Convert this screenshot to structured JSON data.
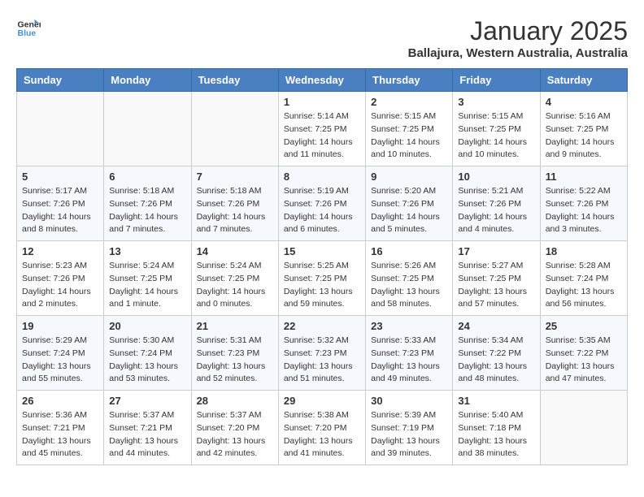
{
  "logo": {
    "line1": "General",
    "line2": "Blue"
  },
  "title": "January 2025",
  "subtitle": "Ballajura, Western Australia, Australia",
  "weekdays": [
    "Sunday",
    "Monday",
    "Tuesday",
    "Wednesday",
    "Thursday",
    "Friday",
    "Saturday"
  ],
  "weeks": [
    [
      {
        "day": "",
        "info": ""
      },
      {
        "day": "",
        "info": ""
      },
      {
        "day": "",
        "info": ""
      },
      {
        "day": "1",
        "info": "Sunrise: 5:14 AM\nSunset: 7:25 PM\nDaylight: 14 hours\nand 11 minutes."
      },
      {
        "day": "2",
        "info": "Sunrise: 5:15 AM\nSunset: 7:25 PM\nDaylight: 14 hours\nand 10 minutes."
      },
      {
        "day": "3",
        "info": "Sunrise: 5:15 AM\nSunset: 7:25 PM\nDaylight: 14 hours\nand 10 minutes."
      },
      {
        "day": "4",
        "info": "Sunrise: 5:16 AM\nSunset: 7:25 PM\nDaylight: 14 hours\nand 9 minutes."
      }
    ],
    [
      {
        "day": "5",
        "info": "Sunrise: 5:17 AM\nSunset: 7:26 PM\nDaylight: 14 hours\nand 8 minutes."
      },
      {
        "day": "6",
        "info": "Sunrise: 5:18 AM\nSunset: 7:26 PM\nDaylight: 14 hours\nand 7 minutes."
      },
      {
        "day": "7",
        "info": "Sunrise: 5:18 AM\nSunset: 7:26 PM\nDaylight: 14 hours\nand 7 minutes."
      },
      {
        "day": "8",
        "info": "Sunrise: 5:19 AM\nSunset: 7:26 PM\nDaylight: 14 hours\nand 6 minutes."
      },
      {
        "day": "9",
        "info": "Sunrise: 5:20 AM\nSunset: 7:26 PM\nDaylight: 14 hours\nand 5 minutes."
      },
      {
        "day": "10",
        "info": "Sunrise: 5:21 AM\nSunset: 7:26 PM\nDaylight: 14 hours\nand 4 minutes."
      },
      {
        "day": "11",
        "info": "Sunrise: 5:22 AM\nSunset: 7:26 PM\nDaylight: 14 hours\nand 3 minutes."
      }
    ],
    [
      {
        "day": "12",
        "info": "Sunrise: 5:23 AM\nSunset: 7:26 PM\nDaylight: 14 hours\nand 2 minutes."
      },
      {
        "day": "13",
        "info": "Sunrise: 5:24 AM\nSunset: 7:25 PM\nDaylight: 14 hours\nand 1 minute."
      },
      {
        "day": "14",
        "info": "Sunrise: 5:24 AM\nSunset: 7:25 PM\nDaylight: 14 hours\nand 0 minutes."
      },
      {
        "day": "15",
        "info": "Sunrise: 5:25 AM\nSunset: 7:25 PM\nDaylight: 13 hours\nand 59 minutes."
      },
      {
        "day": "16",
        "info": "Sunrise: 5:26 AM\nSunset: 7:25 PM\nDaylight: 13 hours\nand 58 minutes."
      },
      {
        "day": "17",
        "info": "Sunrise: 5:27 AM\nSunset: 7:25 PM\nDaylight: 13 hours\nand 57 minutes."
      },
      {
        "day": "18",
        "info": "Sunrise: 5:28 AM\nSunset: 7:24 PM\nDaylight: 13 hours\nand 56 minutes."
      }
    ],
    [
      {
        "day": "19",
        "info": "Sunrise: 5:29 AM\nSunset: 7:24 PM\nDaylight: 13 hours\nand 55 minutes."
      },
      {
        "day": "20",
        "info": "Sunrise: 5:30 AM\nSunset: 7:24 PM\nDaylight: 13 hours\nand 53 minutes."
      },
      {
        "day": "21",
        "info": "Sunrise: 5:31 AM\nSunset: 7:23 PM\nDaylight: 13 hours\nand 52 minutes."
      },
      {
        "day": "22",
        "info": "Sunrise: 5:32 AM\nSunset: 7:23 PM\nDaylight: 13 hours\nand 51 minutes."
      },
      {
        "day": "23",
        "info": "Sunrise: 5:33 AM\nSunset: 7:23 PM\nDaylight: 13 hours\nand 49 minutes."
      },
      {
        "day": "24",
        "info": "Sunrise: 5:34 AM\nSunset: 7:22 PM\nDaylight: 13 hours\nand 48 minutes."
      },
      {
        "day": "25",
        "info": "Sunrise: 5:35 AM\nSunset: 7:22 PM\nDaylight: 13 hours\nand 47 minutes."
      }
    ],
    [
      {
        "day": "26",
        "info": "Sunrise: 5:36 AM\nSunset: 7:21 PM\nDaylight: 13 hours\nand 45 minutes."
      },
      {
        "day": "27",
        "info": "Sunrise: 5:37 AM\nSunset: 7:21 PM\nDaylight: 13 hours\nand 44 minutes."
      },
      {
        "day": "28",
        "info": "Sunrise: 5:37 AM\nSunset: 7:20 PM\nDaylight: 13 hours\nand 42 minutes."
      },
      {
        "day": "29",
        "info": "Sunrise: 5:38 AM\nSunset: 7:20 PM\nDaylight: 13 hours\nand 41 minutes."
      },
      {
        "day": "30",
        "info": "Sunrise: 5:39 AM\nSunset: 7:19 PM\nDaylight: 13 hours\nand 39 minutes."
      },
      {
        "day": "31",
        "info": "Sunrise: 5:40 AM\nSunset: 7:18 PM\nDaylight: 13 hours\nand 38 minutes."
      },
      {
        "day": "",
        "info": ""
      }
    ]
  ]
}
